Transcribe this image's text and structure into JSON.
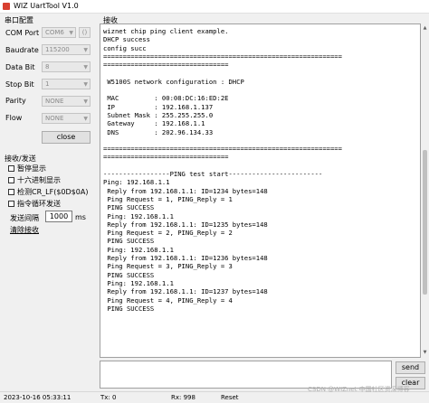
{
  "window": {
    "title": "WIZ UartTool V1.0",
    "icon": "app-icon"
  },
  "serial_config": {
    "section_label": "串口配置",
    "fields": [
      {
        "label": "COM Port",
        "value": "COM6"
      },
      {
        "label": "Baudrate",
        "value": "115200"
      },
      {
        "label": "Data Bit",
        "value": "8"
      },
      {
        "label": "Stop Bit",
        "value": "1"
      },
      {
        "label": "Parity",
        "value": "NONE"
      },
      {
        "label": "Flow",
        "value": "NONE"
      }
    ],
    "refresh_label": "()",
    "close_label": "close"
  },
  "recv_send": {
    "section_label": "接收/发送",
    "options": [
      "暂停显示",
      "十六进制显示",
      "检测CR_LF($0D$0A)",
      "指令循环发送"
    ],
    "send_interval_label": "发送间隔",
    "send_interval_value": "1000",
    "send_interval_unit": "ms",
    "clear_recv_label": "清除接收"
  },
  "receive": {
    "section_label": "接收",
    "text": "wiznet chip ping client example.\nDHCP success\nconfig succ\n=============================================================\n================================\n\n W5100S network configuration : DHCP\n\n MAC         : 00:08:DC:16:ED:2E\n IP          : 192.168.1.137\n Subnet Mask : 255.255.255.0\n Gateway     : 192.168.1.1\n DNS         : 202.96.134.33\n\n=============================================================\n================================\n\n-----------------PING test start------------------------\nPing: 192.168.1.1\n Reply from 192.168.1.1: ID=1234 bytes=148\n Ping Request = 1, PING_Reply = 1\n PING SUCCESS\n Ping: 192.168.1.1\n Reply from 192.168.1.1: ID=1235 bytes=148\n Ping Request = 2, PING_Reply = 2\n PING SUCCESS\n Ping: 192.168.1.1\n Reply from 192.168.1.1: ID=1236 bytes=148\n Ping Request = 3, PING_Reply = 3\n PING SUCCESS\n Ping: 192.168.1.1\n Reply from 192.168.1.1: ID=1237 bytes=148\n Ping Request = 4, PING_Reply = 4\n PING SUCCESS"
  },
  "send": {
    "send_label": "send",
    "clear_label": "clear"
  },
  "statusbar": {
    "datetime": "2023-10-16 05:33:11",
    "tx": "Tx: 0",
    "rx": "Rx: 998",
    "reset": "Reset"
  },
  "watermark": "CSDN @WIZnet 中国社区资深博客"
}
